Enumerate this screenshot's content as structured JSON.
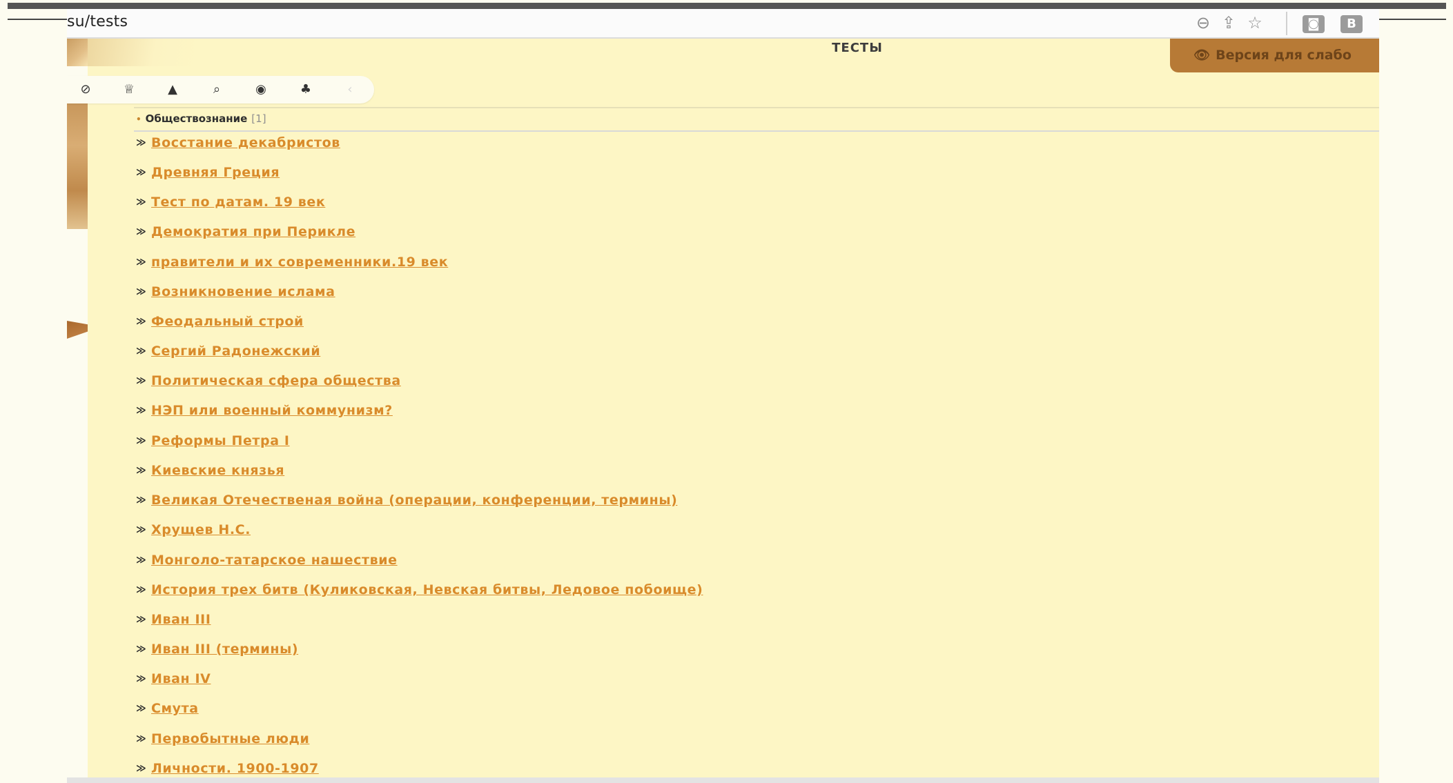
{
  "browser": {
    "url_partial": "su/tests",
    "toolbar_icons": [
      "zoom-out-icon",
      "share-icon",
      "star-icon"
    ],
    "extensions": [
      {
        "icon": "camera-extension-icon",
        "glyph": "◙"
      },
      {
        "icon": "b-extension-icon",
        "glyph": "B"
      }
    ]
  },
  "header": {
    "title": "ТЕСТЫ",
    "low_vision_label": "Версия для слабо",
    "low_vision_icon": "👁"
  },
  "toolbar": {
    "icons": [
      {
        "name": "block-icon",
        "glyph": "⊘"
      },
      {
        "name": "cup-icon",
        "glyph": "♕"
      },
      {
        "name": "bell-icon",
        "glyph": "▲"
      },
      {
        "name": "search-icon",
        "glyph": "⌕"
      },
      {
        "name": "eye-icon",
        "glyph": "◉"
      },
      {
        "name": "puzzle-icon",
        "glyph": "♣"
      },
      {
        "name": "arrow-icon",
        "glyph": "‹"
      }
    ]
  },
  "category": {
    "bullet": "•",
    "label": "Обществознание",
    "count": "[1]"
  },
  "tests": {
    "marker": "≫",
    "items": [
      "Восстание декабристов",
      "Древняя Греция",
      "Тест по датам. 19 век",
      "Демократия при Перикле",
      "правители и их современники.19 век",
      "Возникновение ислама",
      "Феодальный строй",
      "Сергий Радонежский",
      "Политическая сфера общества",
      "НЭП или военный коммунизм?",
      "Реформы Петра I",
      "Киевские князья",
      "Великая Отечественая война (операции, конференции, термины)",
      "Хрущев Н.С.",
      "Монголо-татарское нашествие",
      "История трех битв (Куликовская, Невская битвы, Ледовое побоище)",
      "Иван III",
      "Иван III (термины)",
      "Иван IV",
      "Смута",
      "Первобытные люди",
      "Личности. 1900-1907"
    ]
  },
  "colors": {
    "page_background": "#fdf6c5",
    "link": "#d98b2b",
    "tab": "#b77a36"
  }
}
